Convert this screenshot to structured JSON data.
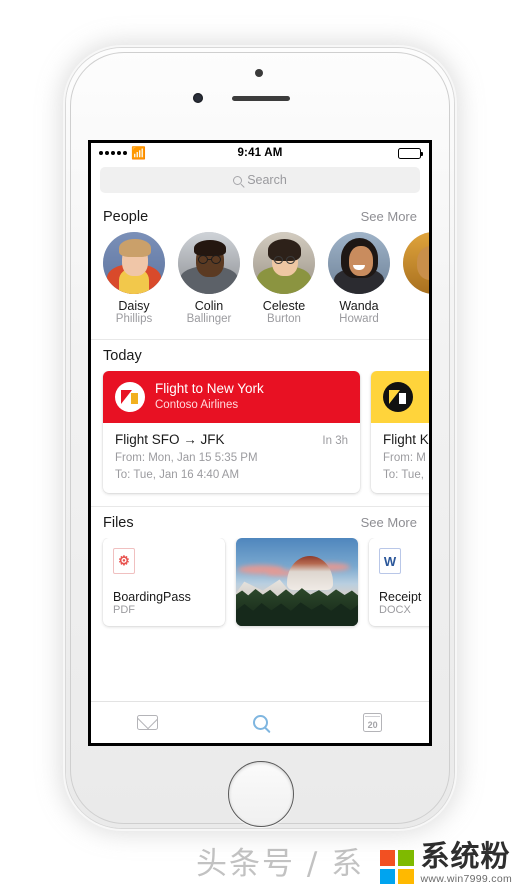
{
  "status_bar": {
    "carrier_dots": 5,
    "wifi_icon": "wifi-icon",
    "time": "9:41 AM",
    "battery_icon": "battery-full-icon"
  },
  "search": {
    "placeholder": "Search",
    "icon": "search-icon"
  },
  "sections": {
    "people": {
      "title": "People",
      "see_more": "See More",
      "items": [
        {
          "first": "Daisy",
          "last": "Phillips",
          "avatar": "avatar-daisy"
        },
        {
          "first": "Colin",
          "last": "Ballinger",
          "avatar": "avatar-colin"
        },
        {
          "first": "Celeste",
          "last": "Burton",
          "avatar": "avatar-celeste"
        },
        {
          "first": "Wanda",
          "last": "Howard",
          "avatar": "avatar-wanda"
        },
        {
          "first": "",
          "last": "",
          "avatar": "avatar-partial"
        }
      ]
    },
    "today": {
      "title": "Today",
      "cards": [
        {
          "banner_color": "#e81123",
          "banner_title": "Flight to New York",
          "banner_sub": "Contoso Airlines",
          "logo": "airline-logo-contoso",
          "route": "Flight SFO → JFK",
          "eta": "In 3h",
          "from": "From: Mon, Jan 15 5:35 PM",
          "to": "To: Tue, Jan 16 4:40 AM"
        },
        {
          "banner_color": "#ffd43b",
          "banner_title": "",
          "banner_sub": "",
          "logo": "airline-logo-dark",
          "route": "Flight K",
          "eta": "",
          "from": "From: M",
          "to": "To: Tue,"
        }
      ]
    },
    "files": {
      "title": "Files",
      "see_more": "See More",
      "items": [
        {
          "kind": "doc",
          "icon": "pdf-icon",
          "name": "BoardingPass",
          "type": "PDF"
        },
        {
          "kind": "photo",
          "icon": "photo-thumbnail",
          "name": "",
          "type": ""
        },
        {
          "kind": "doc",
          "icon": "word-icon",
          "name": "Receipt",
          "type": "DOCX"
        }
      ]
    }
  },
  "tab_bar": {
    "tabs": [
      {
        "icon": "mail-icon",
        "active": false
      },
      {
        "icon": "search-icon",
        "active": true
      },
      {
        "icon": "calendar-icon",
        "active": false,
        "day": "20"
      }
    ]
  },
  "watermark": {
    "text_cn": "头条号 / 系",
    "brand_cn": "系统粉",
    "brand_url": "www.win7999.com",
    "logo": "microsoft-logo"
  },
  "colors": {
    "accent_red": "#e81123",
    "accent_yellow": "#ffd43b",
    "active_tab": "#7fb6e0",
    "muted_text": "#9b9b9f"
  }
}
